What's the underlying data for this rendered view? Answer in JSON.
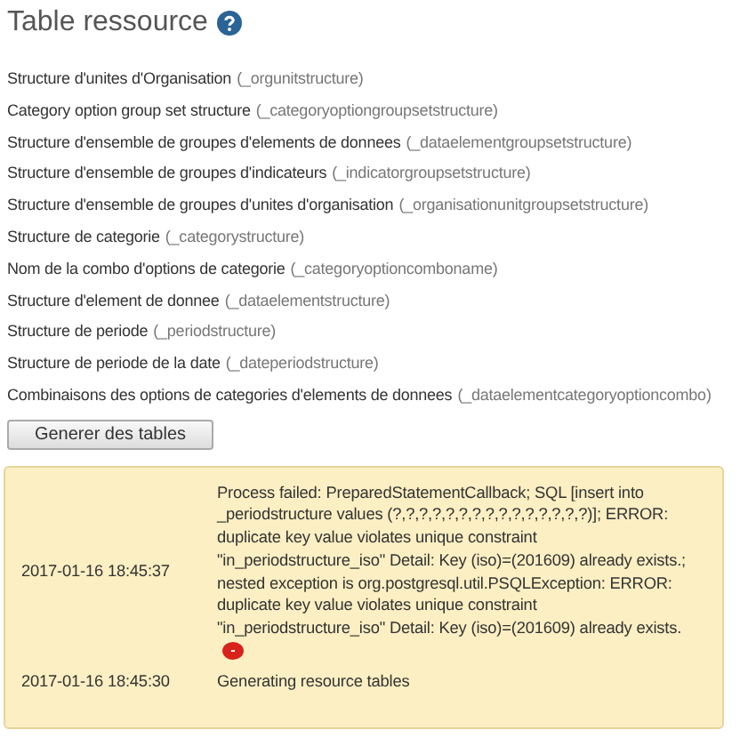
{
  "title": "Table ressource",
  "tables": [
    {
      "name": "Structure d'unites d'Organisation",
      "code": "(_orgunitstructure)"
    },
    {
      "name": "Category option group set structure",
      "code": "(_categoryoptiongroupsetstructure)"
    },
    {
      "name": "Structure d'ensemble de groupes d'elements de donnees",
      "code": "(_dataelementgroupsetstructure)"
    },
    {
      "name": "Structure d'ensemble de groupes d'indicateurs",
      "code": "(_indicatorgroupsetstructure)"
    },
    {
      "name": "Structure d'ensemble de groupes d'unites d'organisation",
      "code": "(_organisationunitgroupsetstructure)"
    },
    {
      "name": "Structure de categorie",
      "code": "(_categorystructure)"
    },
    {
      "name": "Nom de la combo d'options de categorie",
      "code": "(_categoryoptioncomboname)"
    },
    {
      "name": "Structure d'element de donnee",
      "code": "(_dataelementstructure)"
    },
    {
      "name": "Structure de periode",
      "code": "(_periodstructure)"
    },
    {
      "name": "Structure de periode de la date",
      "code": "(_dateperiodstructure)"
    },
    {
      "name": "Combinaisons des options de categories d'elements de donnees",
      "code": "(_dataelementcategoryoptioncombo)"
    }
  ],
  "button": "Generer des tables",
  "log": [
    {
      "time": "2017-01-16 18:45:37",
      "message": "Process failed: PreparedStatementCallback; SQL [insert into _periodstructure values (?,?,?,?,?,?,?,?,?,?,?,?,?,?,?)]; ERROR: duplicate key value violates unique constraint \"in_periodstructure_iso\" Detail: Key (iso)=(201609) already exists.; nested exception is org.postgresql.util.PSQLException: ERROR: duplicate key value violates unique constraint \"in_periodstructure_iso\" Detail: Key (iso)=(201609) already exists.",
      "failed": true
    },
    {
      "time": "2017-01-16 18:45:30",
      "message": "Generating resource tables",
      "failed": false
    }
  ]
}
